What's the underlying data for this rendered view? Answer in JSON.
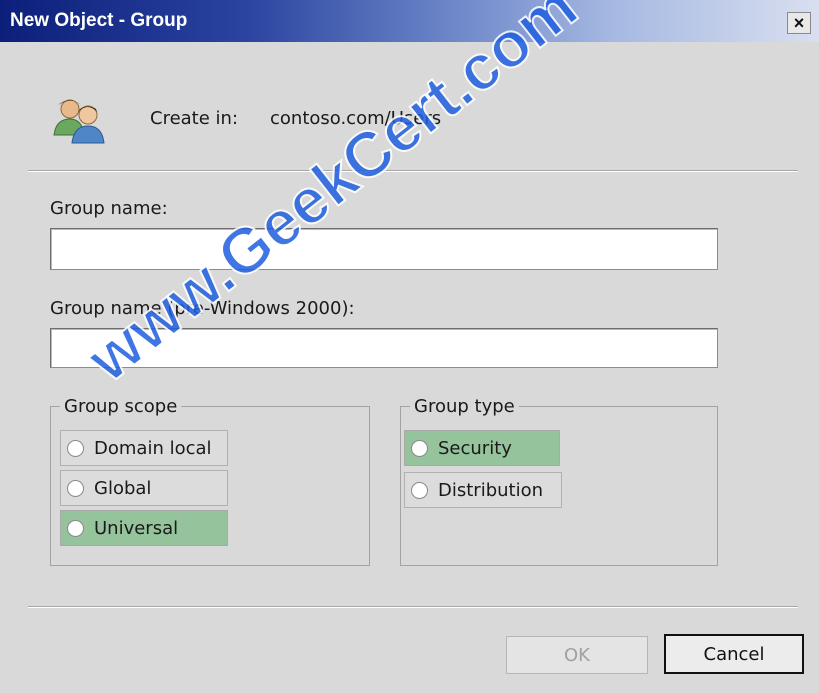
{
  "window": {
    "title": "New Object - Group",
    "close_label": "×"
  },
  "header": {
    "create_in_label": "Create in:",
    "create_in_value": "contoso.com/Users",
    "icon": "users-group-icon"
  },
  "form": {
    "group_name_label": "Group name:",
    "group_name_value": "",
    "pre2000_label": "Group name (pre-Windows 2000):",
    "pre2000_value": ""
  },
  "group_scope": {
    "legend": "Group scope",
    "options": [
      "Domain local",
      "Global",
      "Universal"
    ],
    "selected": "Universal"
  },
  "group_type": {
    "legend": "Group type",
    "options": [
      "Security",
      "Distribution"
    ],
    "selected": "Security"
  },
  "buttons": {
    "ok": "OK",
    "cancel": "Cancel"
  },
  "watermark": "www.GeekCert.com",
  "colors": {
    "selected_highlight": "#95c39b",
    "title_gradient_start": "#0c1f7a",
    "watermark": "#1f5fe0"
  }
}
